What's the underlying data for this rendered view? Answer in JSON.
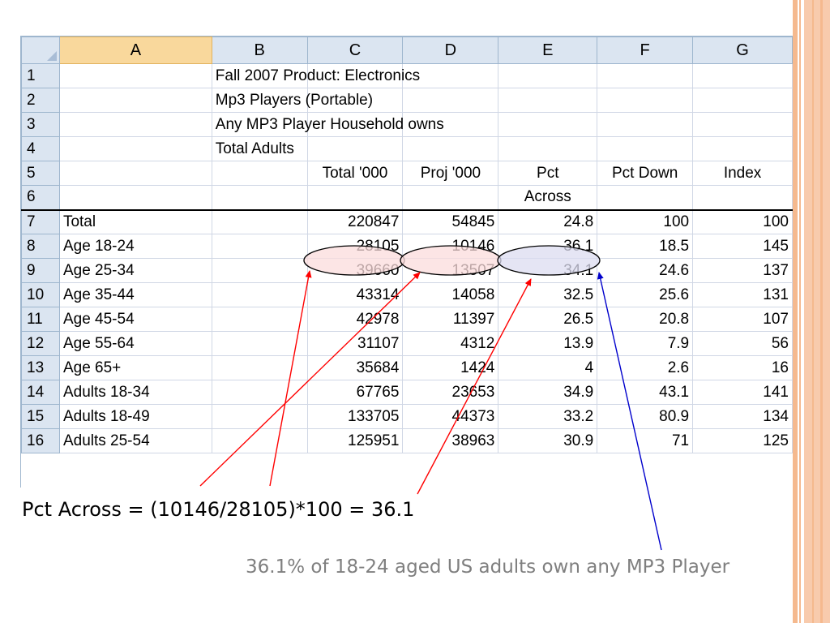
{
  "colors": {
    "accent": "#f5b98e",
    "highlight_pink": "#fbdcdc",
    "highlight_blue": "#dcdcf0",
    "arrow_red": "#ff0000",
    "arrow_blue": "#0000cc",
    "caption": "#7f7f7f"
  },
  "sheet": {
    "corner_icon": "select-all-triangle-icon",
    "columns": [
      "A",
      "B",
      "C",
      "D",
      "E",
      "F",
      "G"
    ],
    "rows": [
      "1",
      "2",
      "3",
      "4",
      "5",
      "6",
      "7",
      "8",
      "9",
      "10",
      "11",
      "12",
      "13",
      "14",
      "15",
      "16"
    ],
    "title_lines": [
      "Fall 2007 Product: Electronics",
      "Mp3 Players (Portable)",
      "Any MP3 Player Household owns",
      "Total Adults"
    ],
    "headers": {
      "total": "Total '000",
      "proj": "Proj '000",
      "pct_across_1": "Pct",
      "pct_across_2": "Across",
      "pct_down": "Pct Down",
      "index": "Index"
    },
    "data": [
      {
        "label": "Total",
        "total": "220847",
        "proj": "54845",
        "pct_across": "24.8",
        "pct_down": "100",
        "index": "100"
      },
      {
        "label": "Age 18-24",
        "total": "28105",
        "proj": "10146",
        "pct_across": "36.1",
        "pct_down": "18.5",
        "index": "145"
      },
      {
        "label": "Age 25-34",
        "total": "39660",
        "proj": "13507",
        "pct_across": "34.1",
        "pct_down": "24.6",
        "index": "137"
      },
      {
        "label": "Age 35-44",
        "total": "43314",
        "proj": "14058",
        "pct_across": "32.5",
        "pct_down": "25.6",
        "index": "131"
      },
      {
        "label": "Age 45-54",
        "total": "42978",
        "proj": "11397",
        "pct_across": "26.5",
        "pct_down": "20.8",
        "index": "107"
      },
      {
        "label": "Age 55-64",
        "total": "31107",
        "proj": "4312",
        "pct_across": "13.9",
        "pct_down": "7.9",
        "index": "56"
      },
      {
        "label": "Age 65+",
        "total": "35684",
        "proj": "1424",
        "pct_across": "4",
        "pct_down": "2.6",
        "index": "16"
      },
      {
        "label": "Adults 18-34",
        "total": "67765",
        "proj": "23653",
        "pct_across": "34.9",
        "pct_down": "43.1",
        "index": "141"
      },
      {
        "label": "Adults 18-49",
        "total": "133705",
        "proj": "44373",
        "pct_across": "33.2",
        "pct_down": "80.9",
        "index": "134"
      },
      {
        "label": "Adults 25-54",
        "total": "125951",
        "proj": "38963",
        "pct_across": "30.9",
        "pct_down": "71",
        "index": "125"
      }
    ]
  },
  "formula_text": "Pct Across = (10146/28105)*100 = 36.1",
  "caption_text": "36.1% of 18-24 aged US adults own any MP3 Player"
}
